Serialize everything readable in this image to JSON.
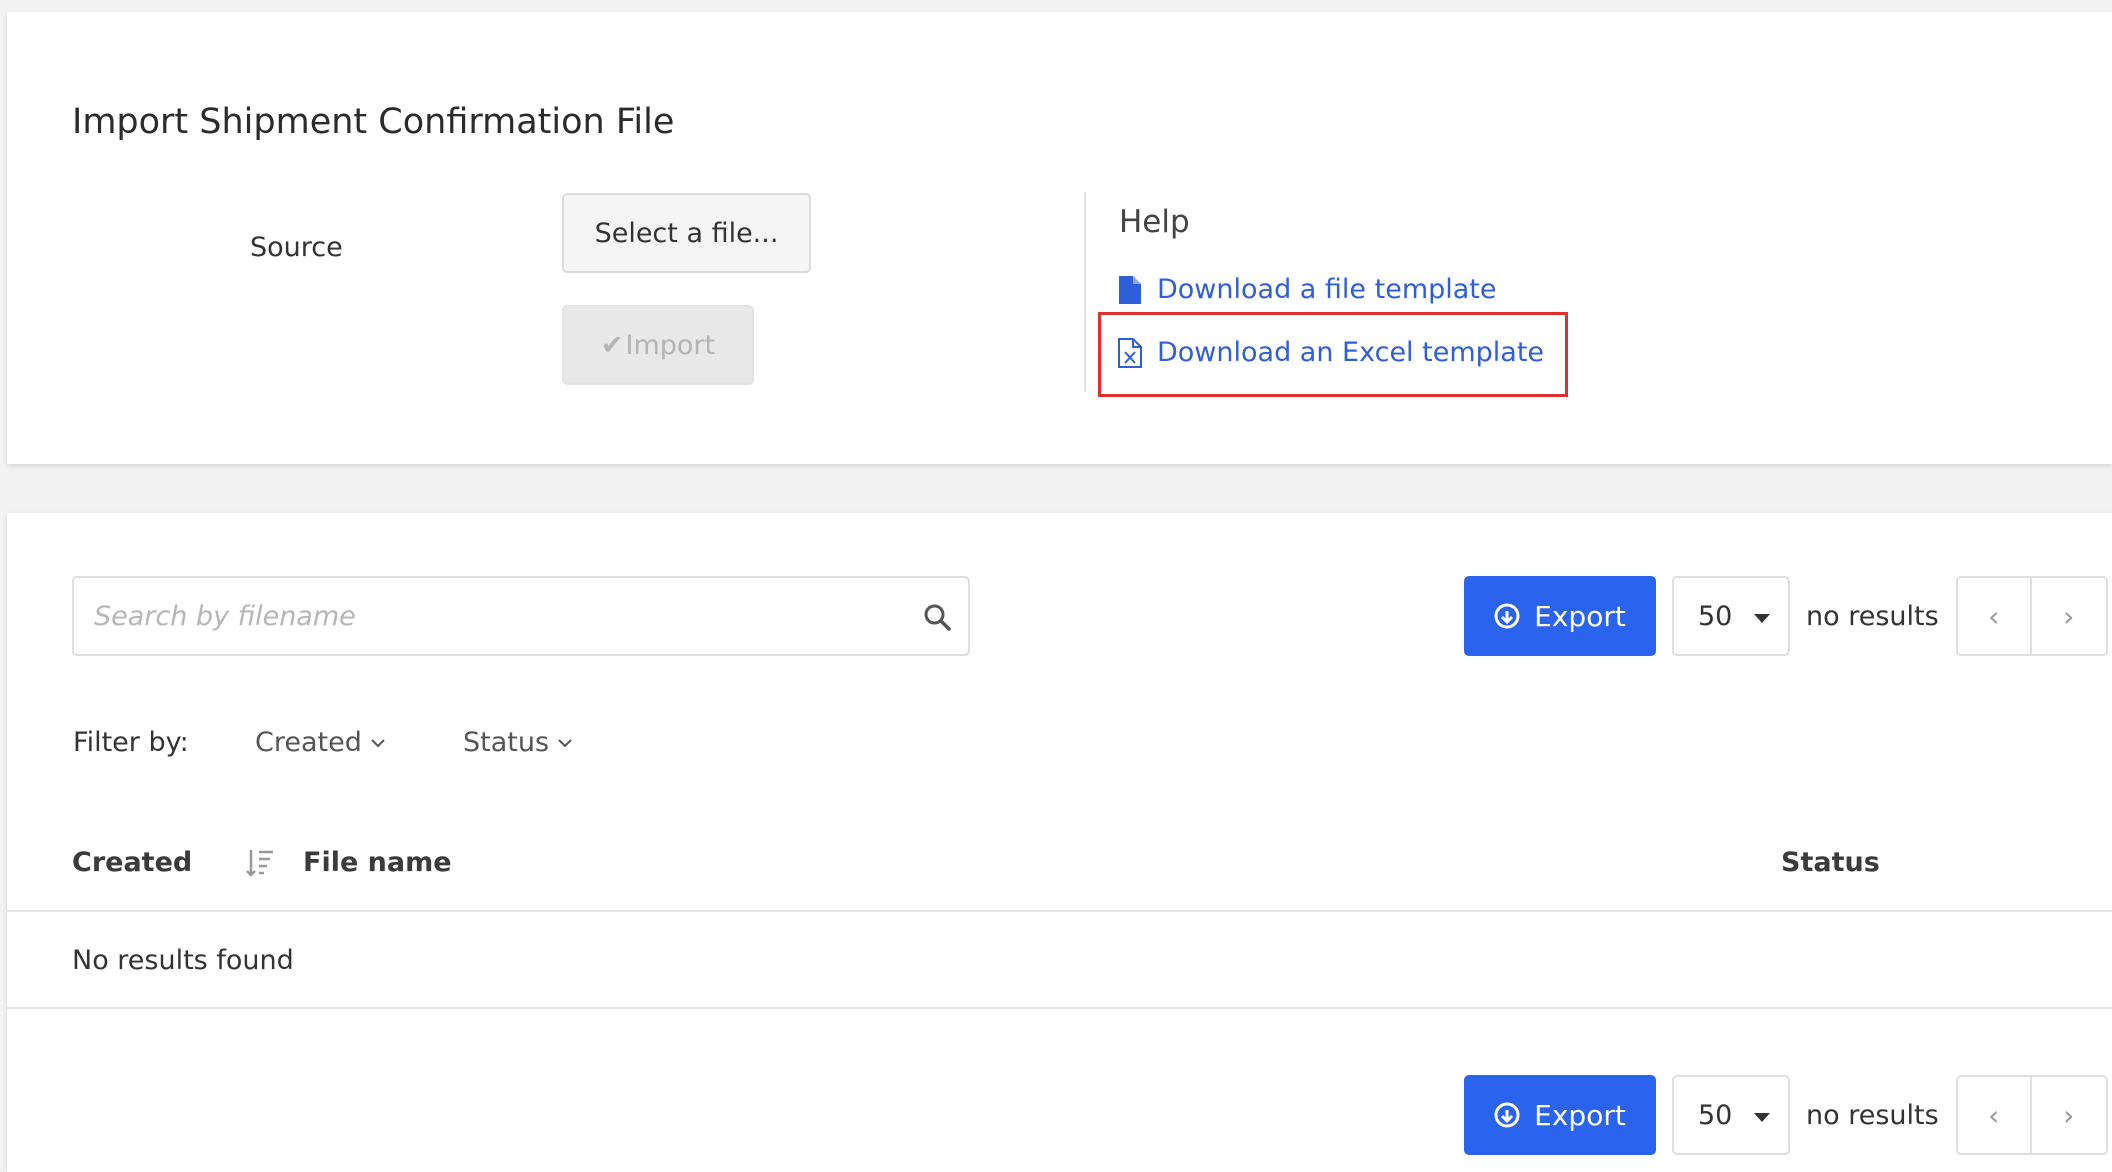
{
  "import_panel": {
    "title": "Import Shipment Confirmation File",
    "source_label": "Source",
    "select_file_label": "Select a file...",
    "import_label": "Import",
    "import_icon": "check-icon"
  },
  "help": {
    "title": "Help",
    "links": [
      {
        "label": "Download a file template",
        "icon": "file-icon"
      },
      {
        "label": "Download an Excel template",
        "icon": "excel-file-icon",
        "highlighted": true
      }
    ],
    "highlight_color": "#e0302e"
  },
  "toolbar": {
    "search_placeholder": "Search by filename",
    "export_label": "Export",
    "page_size": "50",
    "results_text": "no results",
    "prev_label": "‹",
    "next_label": "›"
  },
  "filters": {
    "label": "Filter by:",
    "items": [
      "Created",
      "Status"
    ]
  },
  "table": {
    "columns": [
      "Created",
      "File name",
      "Status"
    ],
    "empty_message": "No results found"
  },
  "colors": {
    "accent": "#2a63ee",
    "link": "#2f5fd8",
    "background": "#f2f2f2"
  }
}
